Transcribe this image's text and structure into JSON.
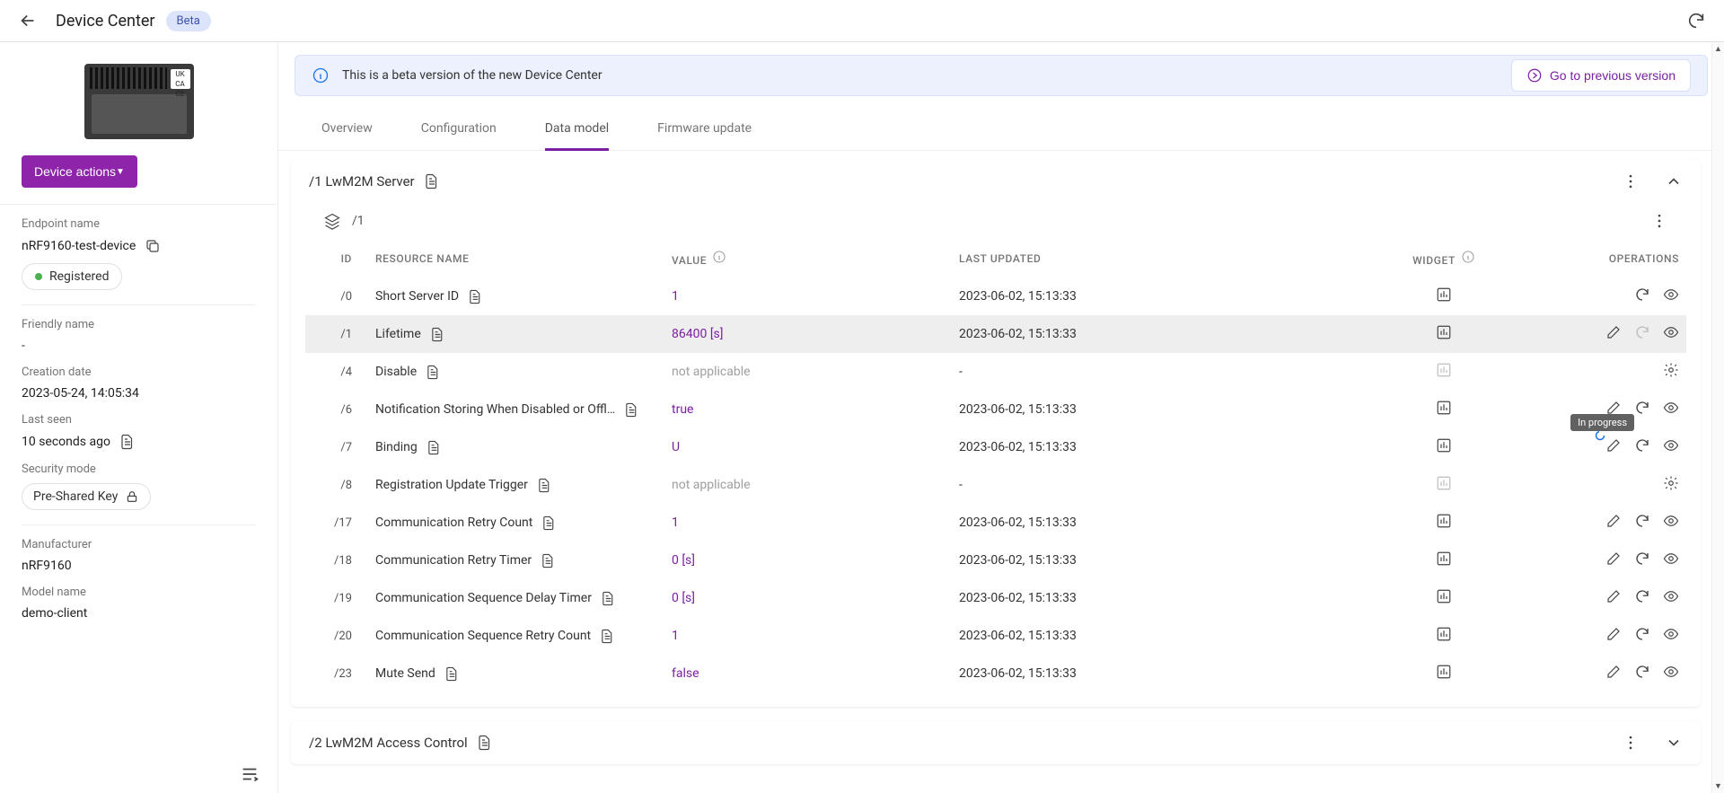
{
  "header": {
    "title": "Device Center",
    "badge": "Beta"
  },
  "banner": {
    "text": "This is a beta version of the new Device Center",
    "prev_btn": "Go to previous version"
  },
  "tabs": [
    "Overview",
    "Configuration",
    "Data model",
    "Firmware update"
  ],
  "active_tab": "Data model",
  "sidebar": {
    "actions_btn": "Device actions",
    "endpoint_label": "Endpoint name",
    "endpoint_value": "nRF9160-test-device",
    "status": "Registered",
    "friendly_label": "Friendly name",
    "friendly_value": "-",
    "creation_label": "Creation date",
    "creation_value": "2023-05-24, 14:05:34",
    "lastseen_label": "Last seen",
    "lastseen_value": "10 seconds ago",
    "security_label": "Security mode",
    "security_value": "Pre-Shared Key",
    "manufacturer_label": "Manufacturer",
    "manufacturer_value": "nRF9160",
    "model_label": "Model name",
    "model_value": "demo-client"
  },
  "panel1": {
    "title": "/1 LwM2M Server",
    "subpath": "/1",
    "headers": {
      "id": "ID",
      "name": "RESOURCE NAME",
      "value": "VALUE",
      "updated": "LAST UPDATED",
      "widget": "WIDGET",
      "ops": "OPERATIONS"
    },
    "rows": [
      {
        "id": "/0",
        "name": "Short Server ID",
        "value": "1",
        "na": false,
        "updated": "2023-06-02, 15:13:33",
        "ops": "ro",
        "widget": true
      },
      {
        "id": "/1",
        "name": "Lifetime",
        "value": "86400 [s]",
        "na": false,
        "updated": "2023-06-02, 15:13:33",
        "ops": "rwo_loading",
        "widget": true,
        "highlight": true,
        "tooltip": "In progress"
      },
      {
        "id": "/4",
        "name": "Disable",
        "value": "not applicable",
        "na": true,
        "updated": "-",
        "ops": "exec",
        "widget": false
      },
      {
        "id": "/6",
        "name": "Notification Storing When Disabled or Offl…",
        "value": "true",
        "na": false,
        "updated": "2023-06-02, 15:13:33",
        "ops": "rwo",
        "widget": true
      },
      {
        "id": "/7",
        "name": "Binding",
        "value": "U",
        "na": false,
        "updated": "2023-06-02, 15:13:33",
        "ops": "rwo",
        "widget": true
      },
      {
        "id": "/8",
        "name": "Registration Update Trigger",
        "value": "not applicable",
        "na": true,
        "updated": "-",
        "ops": "exec",
        "widget": false
      },
      {
        "id": "/17",
        "name": "Communication Retry Count",
        "value": "1",
        "na": false,
        "updated": "2023-06-02, 15:13:33",
        "ops": "rwo",
        "widget": true
      },
      {
        "id": "/18",
        "name": "Communication Retry Timer",
        "value": "0 [s]",
        "na": false,
        "updated": "2023-06-02, 15:13:33",
        "ops": "rwo",
        "widget": true
      },
      {
        "id": "/19",
        "name": "Communication Sequence Delay Timer",
        "value": "0 [s]",
        "na": false,
        "updated": "2023-06-02, 15:13:33",
        "ops": "rwo",
        "widget": true
      },
      {
        "id": "/20",
        "name": "Communication Sequence Retry Count",
        "value": "1",
        "na": false,
        "updated": "2023-06-02, 15:13:33",
        "ops": "rwo",
        "widget": true
      },
      {
        "id": "/23",
        "name": "Mute Send",
        "value": "false",
        "na": false,
        "updated": "2023-06-02, 15:13:33",
        "ops": "rwo",
        "widget": true
      }
    ]
  },
  "panel2": {
    "title": "/2 LwM2M Access Control"
  }
}
